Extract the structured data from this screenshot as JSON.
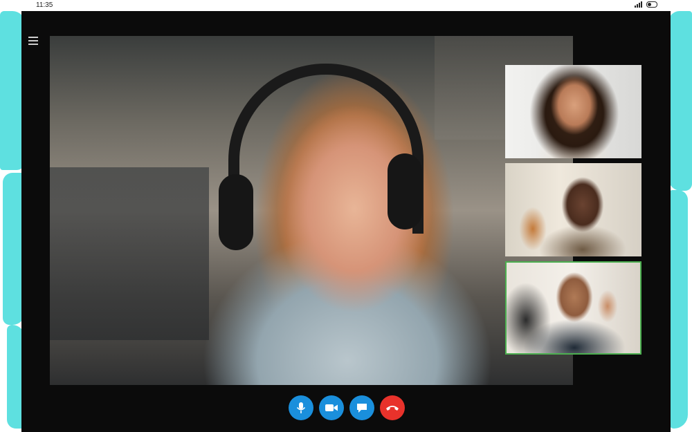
{
  "status_bar": {
    "time": "11:35"
  },
  "call": {
    "participants": [
      {
        "role": "main-speaker"
      },
      {
        "role": "participant"
      },
      {
        "role": "participant"
      },
      {
        "role": "participant",
        "active_speaker": true
      }
    ]
  },
  "controls": [
    {
      "id": "mic",
      "icon": "microphone-icon",
      "color": "#1a8fdc"
    },
    {
      "id": "video",
      "icon": "video-camera-icon",
      "color": "#1a8fdc"
    },
    {
      "id": "chat",
      "icon": "chat-bubble-icon",
      "color": "#1a8fdc"
    },
    {
      "id": "end",
      "icon": "phone-hangup-icon",
      "color": "#e8322b"
    }
  ],
  "colors": {
    "background_accent": "#5ee0e0",
    "tablet_frame": "#0b0b0b",
    "active_border": "#4caf50"
  }
}
